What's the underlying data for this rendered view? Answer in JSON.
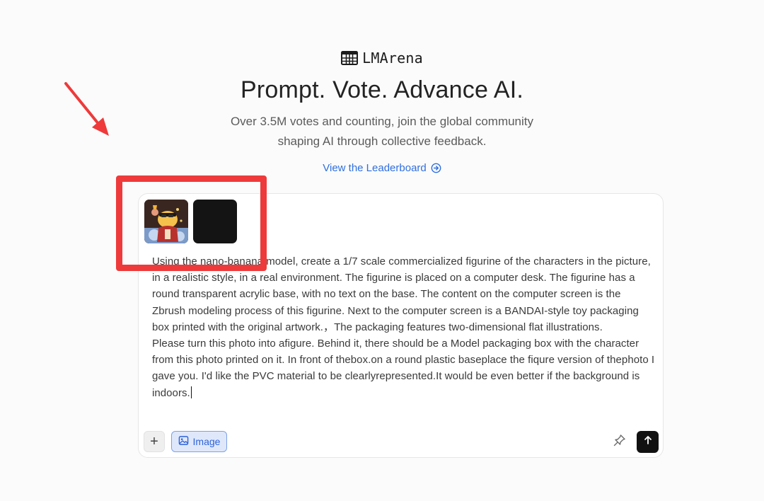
{
  "brand": {
    "name": "LMArena",
    "icon": "grid-table-icon"
  },
  "hero": {
    "headline": "Prompt. Vote. Advance AI.",
    "subline_1": "Over 3.5M votes and counting, join the global community",
    "subline_2": "shaping AI through collective feedback.",
    "leaderboard_link": "View the Leaderboard",
    "leaderboard_icon": "arrow-circle-right-icon"
  },
  "composer": {
    "attachments": [
      {
        "name": "attached-image-cartoon-character",
        "description": "cartoon figure thumbnail"
      },
      {
        "name": "attached-image-black",
        "description": "black image thumbnail"
      }
    ],
    "prompt_text": "Using the nano-banana model, create a 1/7 scale commercialized figurine of the characters in the picture, in a realistic style, in a real environment. The figurine is placed on a computer desk. The figurine has a round transparent acrylic base, with no text on the base. The content on the computer screen is the Zbrush modeling process of this figurine. Next to the computer screen is a BANDAI-style toy packaging box printed with the original artwork.，The packaging features two-dimensional flat illustrations.\nPlease turn this photo into afigure. Behind it, there should be a Model packaging box with the character from this photo printed on it. In front of thebox.on a round plastic baseplace the fiqure version of thephoto I gave you. I'd like the PVC material to be clearlyrepresented.It would be even better if the background is indoors.",
    "plus_label": "+",
    "image_button_label": "Image",
    "image_button_icon": "image-icon",
    "tool_icon": "pin-icon",
    "send_icon": "arrow-up-icon"
  },
  "annotations": {
    "arrow_color": "#ee3a3a",
    "box_color": "#ee3a3a"
  },
  "colors": {
    "accent_link": "#2f6fdf",
    "image_button_bg": "#dfe8fb",
    "send_button_bg": "#111111"
  }
}
